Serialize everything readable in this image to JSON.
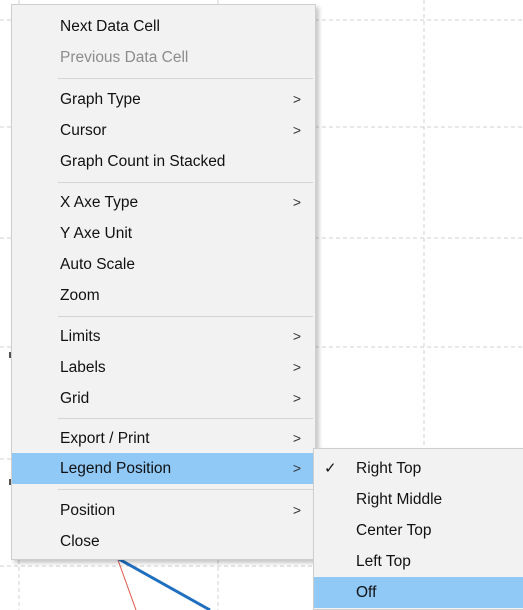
{
  "context_menu": {
    "items": [
      {
        "label": "Next Data Cell",
        "submenu": false,
        "enabled": true
      },
      {
        "label": "Previous Data Cell",
        "submenu": false,
        "enabled": false
      },
      {
        "label": "Graph Type",
        "submenu": true,
        "enabled": true
      },
      {
        "label": "Cursor",
        "submenu": true,
        "enabled": true
      },
      {
        "label": "Graph Count in Stacked",
        "submenu": false,
        "enabled": true
      },
      {
        "label": "X Axe Type",
        "submenu": true,
        "enabled": true
      },
      {
        "label": "Y Axe Unit",
        "submenu": false,
        "enabled": true
      },
      {
        "label": "Auto Scale",
        "submenu": false,
        "enabled": true
      },
      {
        "label": "Zoom",
        "submenu": false,
        "enabled": true
      },
      {
        "label": "Limits",
        "submenu": true,
        "enabled": true
      },
      {
        "label": "Labels",
        "submenu": true,
        "enabled": true
      },
      {
        "label": "Grid",
        "submenu": true,
        "enabled": true
      },
      {
        "label": "Export / Print",
        "submenu": true,
        "enabled": true
      },
      {
        "label": "Legend Position",
        "submenu": true,
        "enabled": true,
        "highlighted": true
      },
      {
        "label": "Position",
        "submenu": true,
        "enabled": true
      },
      {
        "label": "Close",
        "submenu": false,
        "enabled": true
      }
    ],
    "submenu_arrow": ">"
  },
  "legend_position_submenu": {
    "items": [
      {
        "label": "Right Top",
        "checked": true
      },
      {
        "label": "Right Middle",
        "checked": false
      },
      {
        "label": "Center Top",
        "checked": false
      },
      {
        "label": "Left Top",
        "checked": false
      },
      {
        "label": "Off",
        "checked": false,
        "highlighted": true
      }
    ],
    "check_glyph": "✓"
  },
  "colors": {
    "menu_background": "#f2f2f2",
    "highlight": "#90c8f6",
    "disabled_text": "#8c8c8c",
    "grid_line": "#d0d0d0",
    "series_blue": "#1f6fc0",
    "series_red": "#e05a4a"
  }
}
